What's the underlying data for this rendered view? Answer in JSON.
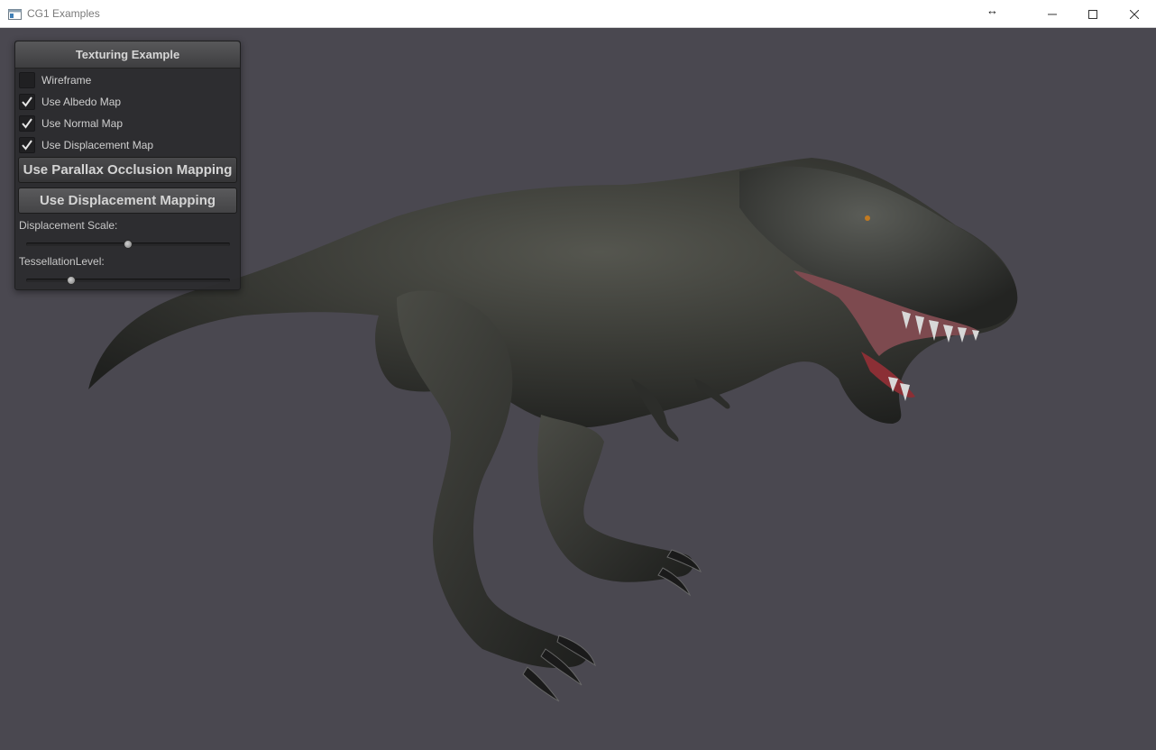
{
  "window": {
    "title": "CG1 Examples",
    "icons": [
      "app-window-icon",
      "minimize-icon",
      "maximize-icon",
      "close-icon",
      "horizontal-resize-cursor-icon"
    ]
  },
  "panel": {
    "title": "Texturing Example",
    "checkboxes": [
      {
        "label": "Wireframe",
        "checked": false
      },
      {
        "label": "Use Albedo Map",
        "checked": true
      },
      {
        "label": "Use Normal Map",
        "checked": true
      },
      {
        "label": "Use Displacement Map",
        "checked": true
      }
    ],
    "buttons": {
      "parallax": "Use Parallax Occlusion Mapping",
      "displacement": "Use Displacement Mapping"
    },
    "sliders": [
      {
        "label": "Displacement Scale:",
        "value_fraction": 0.5
      },
      {
        "label": "TessellationLevel:",
        "value_fraction": 0.22
      }
    ]
  },
  "scene": {
    "subject": "textured-trex-model",
    "background_color": "#4a4850"
  }
}
